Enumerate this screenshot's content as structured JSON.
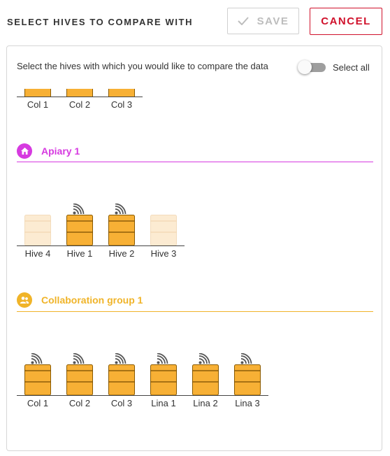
{
  "header": {
    "title": "SELECT HIVES TO COMPARE WITH",
    "save_label": "SAVE",
    "cancel_label": "CANCEL"
  },
  "panel": {
    "instruction": "Select the hives with which you would like to compare the data",
    "select_all_label": "Select all",
    "select_all_on": false
  },
  "colors": {
    "apiary_accent": "#d63ae0",
    "collab_accent": "#f0b429",
    "hive_fill": "#f7b035",
    "hive_fill_disabled": "#fcebd2",
    "cancel_red": "#d0112b"
  },
  "top_group": {
    "hives": [
      {
        "label": "Col 1"
      },
      {
        "label": "Col 2"
      },
      {
        "label": "Col 3"
      }
    ]
  },
  "apiary": {
    "title": "Apiary 1",
    "icon": "home-icon",
    "hives": [
      {
        "label": "Hive 4",
        "enabled": false,
        "signal": false
      },
      {
        "label": "Hive 1",
        "enabled": true,
        "signal": true
      },
      {
        "label": "Hive 2",
        "enabled": true,
        "signal": true
      },
      {
        "label": "Hive 3",
        "enabled": false,
        "signal": false
      }
    ]
  },
  "collab": {
    "title": "Collaboration group 1",
    "icon": "people-icon",
    "hives": [
      {
        "label": "Col 1",
        "enabled": true,
        "signal": true
      },
      {
        "label": "Col 2",
        "enabled": true,
        "signal": true
      },
      {
        "label": "Col 3",
        "enabled": true,
        "signal": true
      },
      {
        "label": "Lina 1",
        "enabled": true,
        "signal": true
      },
      {
        "label": "Lina 2",
        "enabled": true,
        "signal": true
      },
      {
        "label": "Lina 3",
        "enabled": true,
        "signal": true
      }
    ]
  }
}
